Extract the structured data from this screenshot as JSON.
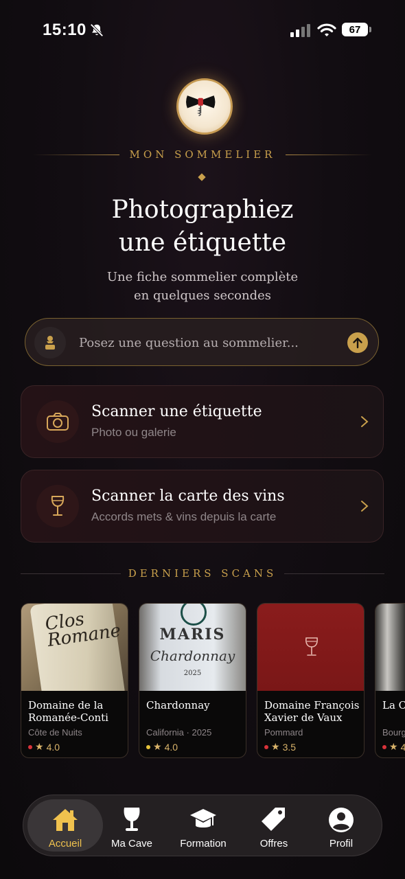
{
  "status_bar": {
    "time": "15:10",
    "battery": "67"
  },
  "header": {
    "brand": "MON SOMMELIER",
    "headline_line1": "Photographiez",
    "headline_line2": "une étiquette",
    "subtitle_line1": "Une fiche sommelier complète",
    "subtitle_line2": "en quelques secondes"
  },
  "ask": {
    "placeholder": "Posez une question au sommelier..."
  },
  "actions": [
    {
      "title": "Scanner une étiquette",
      "subtitle": "Photo ou galerie",
      "icon": "camera-icon"
    },
    {
      "title": "Scanner la carte des vins",
      "subtitle": "Accords mets & vins depuis la carte",
      "icon": "wine-glass-icon"
    }
  ],
  "recent": {
    "title": "DERNIERS SCANS",
    "items": [
      {
        "name": "Domaine de la Romanée-Conti",
        "meta": "Côte de Nuits",
        "rating": "4.0",
        "dot_color": "#d8333a",
        "label_text": "Clos Romane"
      },
      {
        "name": "Chardonnay",
        "meta": "California · 2025",
        "rating": "4.0",
        "dot_color": "#e5c23a",
        "label_text1": "MARIS",
        "label_text2": "Chardonnay",
        "label_text3": "2025"
      },
      {
        "name": "Domaine François Xavier de Vaux",
        "meta": "Pommard",
        "rating": "3.5",
        "dot_color": "#d8333a"
      },
      {
        "name": "La C d'Au",
        "meta": "Bourg",
        "rating": "4",
        "dot_color": "#d8333a"
      }
    ]
  },
  "tabs": [
    {
      "label": "Accueil",
      "icon": "home-icon",
      "active": true
    },
    {
      "label": "Ma Cave",
      "icon": "wine-glass-icon"
    },
    {
      "label": "Formation",
      "icon": "graduation-cap-icon"
    },
    {
      "label": "Offres",
      "icon": "tag-icon"
    },
    {
      "label": "Profil",
      "icon": "profile-icon"
    }
  ],
  "colors": {
    "gold": "#c9a04c",
    "accent_tab": "#f0c24e",
    "background": "#120d12"
  }
}
